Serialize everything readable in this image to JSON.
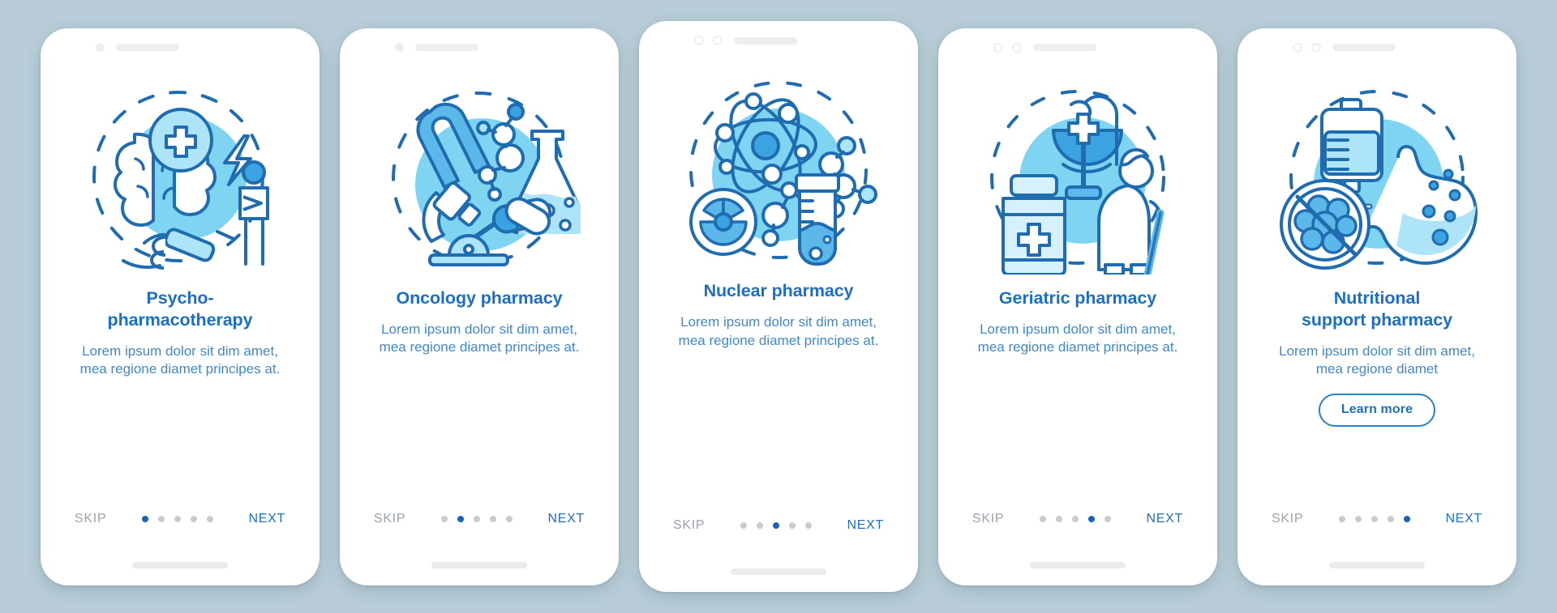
{
  "theme": {
    "page_background": "#b8cdd7",
    "card_background": "#ffffff",
    "title_color": "#1b6fc4",
    "body_color": "#3f88c9",
    "accent_color": "#1565c0",
    "muted_color": "#9aa3ab",
    "illustration_blob": "#7fd4f2",
    "illustration_stroke": "#1f6cb0",
    "illustration_fill_light": "#d6f1fb",
    "illustration_fill_mid": "#5cb8e8"
  },
  "nav": {
    "skip_label": "SKIP",
    "next_label": "NEXT",
    "dot_count": 5
  },
  "screens": [
    {
      "id": "psycho-pharmacotherapy",
      "title": "Psycho-\npharmacotherapy",
      "title_line1": "Psycho-",
      "title_line2": "pharmacotherapy",
      "description": "Lorem ipsum dolor sit dim amet, mea regione diamet principes at.",
      "illustration_name": "brain-syringe-patient-illustration",
      "active_dot": 1,
      "status_icons": [
        "camera-dot",
        "speaker-bar"
      ],
      "has_learn_more": false,
      "learn_more_label": null
    },
    {
      "id": "oncology-pharmacy",
      "title": "Oncology pharmacy",
      "title_line1": "Oncology pharmacy",
      "title_line2": "",
      "description": "Lorem ipsum dolor sit dim amet, mea regione diamet principes at.",
      "illustration_name": "ribbon-microscope-flask-illustration",
      "active_dot": 2,
      "status_icons": [
        "camera-dot",
        "speaker-bar"
      ],
      "has_learn_more": false,
      "learn_more_label": null
    },
    {
      "id": "nuclear-pharmacy",
      "title": "Nuclear pharmacy",
      "title_line1": "Nuclear pharmacy",
      "title_line2": "",
      "description": "Lorem ipsum dolor sit dim amet, mea regione diamet principes at.",
      "illustration_name": "atom-radiation-testtube-illustration",
      "active_dot": 3,
      "status_icons": [
        "camera-ring",
        "camera-ring",
        "speaker-bar"
      ],
      "has_learn_more": false,
      "learn_more_label": null
    },
    {
      "id": "geriatric-pharmacy",
      "title": "Geriatric pharmacy",
      "title_line1": "Geriatric pharmacy",
      "title_line2": "",
      "description": "Lorem ipsum dolor sit dim amet, mea regione diamet principes at.",
      "illustration_name": "pill-bottle-bowl-hygieia-elderly-illustration",
      "active_dot": 4,
      "status_icons": [
        "camera-ring",
        "camera-ring",
        "speaker-bar"
      ],
      "has_learn_more": false,
      "learn_more_label": null
    },
    {
      "id": "nutritional-support-pharmacy",
      "title": "Nutritional support pharmacy",
      "title_line1": "Nutritional",
      "title_line2": "support pharmacy",
      "description": "Lorem ipsum dolor sit dim amet, mea regione diamet",
      "illustration_name": "iv-drip-stomach-nocell-illustration",
      "active_dot": 5,
      "status_icons": [
        "camera-ring",
        "camera-ring",
        "speaker-bar"
      ],
      "has_learn_more": true,
      "learn_more_label": "Learn more"
    }
  ]
}
